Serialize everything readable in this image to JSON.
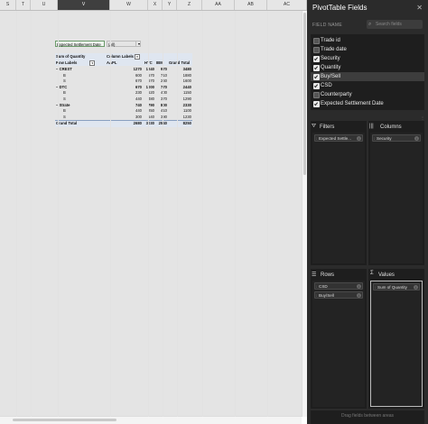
{
  "sheet": {
    "columns": [
      "S",
      "T",
      "U",
      "V",
      "W",
      "X",
      "Y",
      "Z",
      "AA",
      "AB",
      "AC"
    ],
    "selected_column": "V"
  },
  "pivot": {
    "filter_label": "Expected Settlement Date",
    "filter_value": "(All)",
    "values_header": "Sum of Quantity",
    "columns_header": "Column Labels",
    "rows_header": "Row Labels",
    "col_names": [
      "AAPL",
      "HTC",
      "IBM",
      "Grand Total"
    ],
    "rows": [
      {
        "label": "CREST",
        "indent": 0,
        "bold": true,
        "values": [
          "1270",
          "1240",
          "970",
          "3480"
        ]
      },
      {
        "label": "B",
        "indent": 1,
        "bold": false,
        "values": [
          "600",
          "570",
          "710",
          "1880"
        ]
      },
      {
        "label": "S",
        "indent": 1,
        "bold": false,
        "values": [
          "670",
          "670",
          "260",
          "1600"
        ]
      },
      {
        "label": "DTC",
        "indent": 0,
        "bold": true,
        "values": [
          "670",
          "1000",
          "770",
          "2440"
        ]
      },
      {
        "label": "B",
        "indent": 1,
        "bold": false,
        "values": [
          "230",
          "520",
          "400",
          "1150"
        ]
      },
      {
        "label": "S",
        "indent": 1,
        "bold": false,
        "values": [
          "440",
          "480",
          "370",
          "1290"
        ]
      },
      {
        "label": "Strate",
        "indent": 0,
        "bold": true,
        "values": [
          "740",
          "790",
          "800",
          "2330"
        ]
      },
      {
        "label": "B",
        "indent": 1,
        "bold": false,
        "values": [
          "440",
          "250",
          "410",
          "1100"
        ]
      },
      {
        "label": "S",
        "indent": 1,
        "bold": false,
        "values": [
          "300",
          "540",
          "390",
          "1230"
        ]
      }
    ],
    "grand_total_label": "Grand Total",
    "grand_total_values": [
      "2680",
      "3030",
      "2540",
      "8250"
    ]
  },
  "panel": {
    "title": "PivotTable Fields",
    "field_name_label": "FIELD NAME",
    "search_placeholder": "Search fields",
    "fields": [
      {
        "label": "Trade id",
        "checked": false,
        "selected": false
      },
      {
        "label": "Trade date",
        "checked": false,
        "selected": false
      },
      {
        "label": "Security",
        "checked": true,
        "selected": false
      },
      {
        "label": "Quantity",
        "checked": true,
        "selected": false
      },
      {
        "label": "Buy/Sell",
        "checked": true,
        "selected": true
      },
      {
        "label": "CSD",
        "checked": true,
        "selected": false
      },
      {
        "label": "Counterparty",
        "checked": false,
        "selected": false
      },
      {
        "label": "Expected Settlement Date",
        "checked": true,
        "selected": false
      }
    ],
    "filters_title": "Filters",
    "columns_title": "Columns",
    "rows_title": "Rows",
    "values_title": "Values",
    "filters_items": [
      "Expected Settle..."
    ],
    "columns_items": [
      "Security"
    ],
    "rows_items": [
      "CSD",
      "Buy/Sell"
    ],
    "values_items": [
      "Sum of Quantity"
    ],
    "footer_hint": "Drag fields between areas"
  }
}
